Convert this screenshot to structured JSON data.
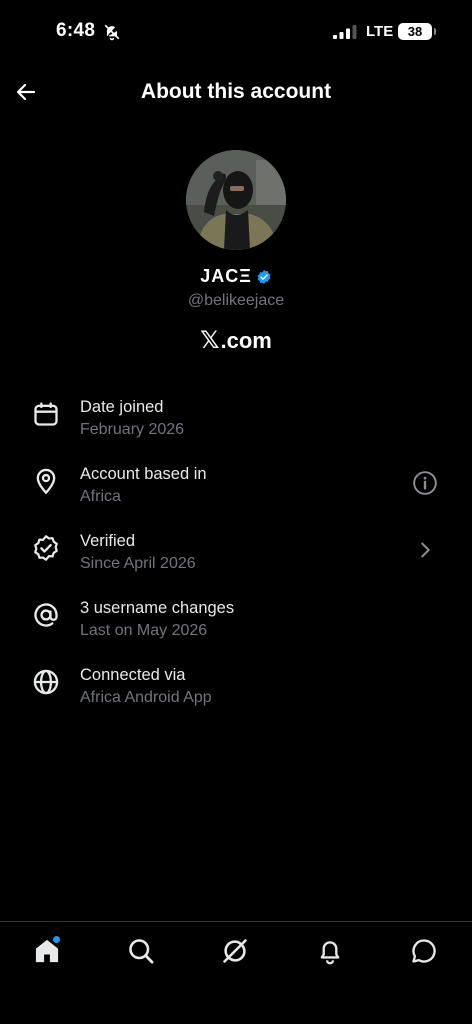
{
  "status_bar": {
    "time": "6:48",
    "network": "LTE",
    "battery": "38"
  },
  "header": {
    "title": "About this account"
  },
  "profile": {
    "display_name": "JACΞ",
    "handle": "@belikeejace",
    "site": "com",
    "site_logo": "𝕏",
    "verified_color": "#1d9bf0"
  },
  "info": [
    {
      "icon": "calendar-icon",
      "label": "Date joined",
      "value": "February 2026"
    },
    {
      "icon": "location-pin-icon",
      "label": "Account based in",
      "value": "Africa",
      "right_icon": "info-icon"
    },
    {
      "icon": "verified-seal-icon",
      "label": "Verified",
      "value": "Since April 2026",
      "right_icon": "chevron-right-icon"
    },
    {
      "icon": "at-sign-icon",
      "label": "3 username changes",
      "value": "Last on May 2026"
    },
    {
      "icon": "globe-icon",
      "label": "Connected via",
      "value": "Africa Android App"
    }
  ],
  "bottom_nav": [
    "home-icon",
    "search-icon",
    "grok-icon",
    "notifications-icon",
    "messages-icon"
  ],
  "colors": {
    "background": "#000000",
    "muted_text": "#71767b",
    "accent": "#1d9bf0"
  }
}
